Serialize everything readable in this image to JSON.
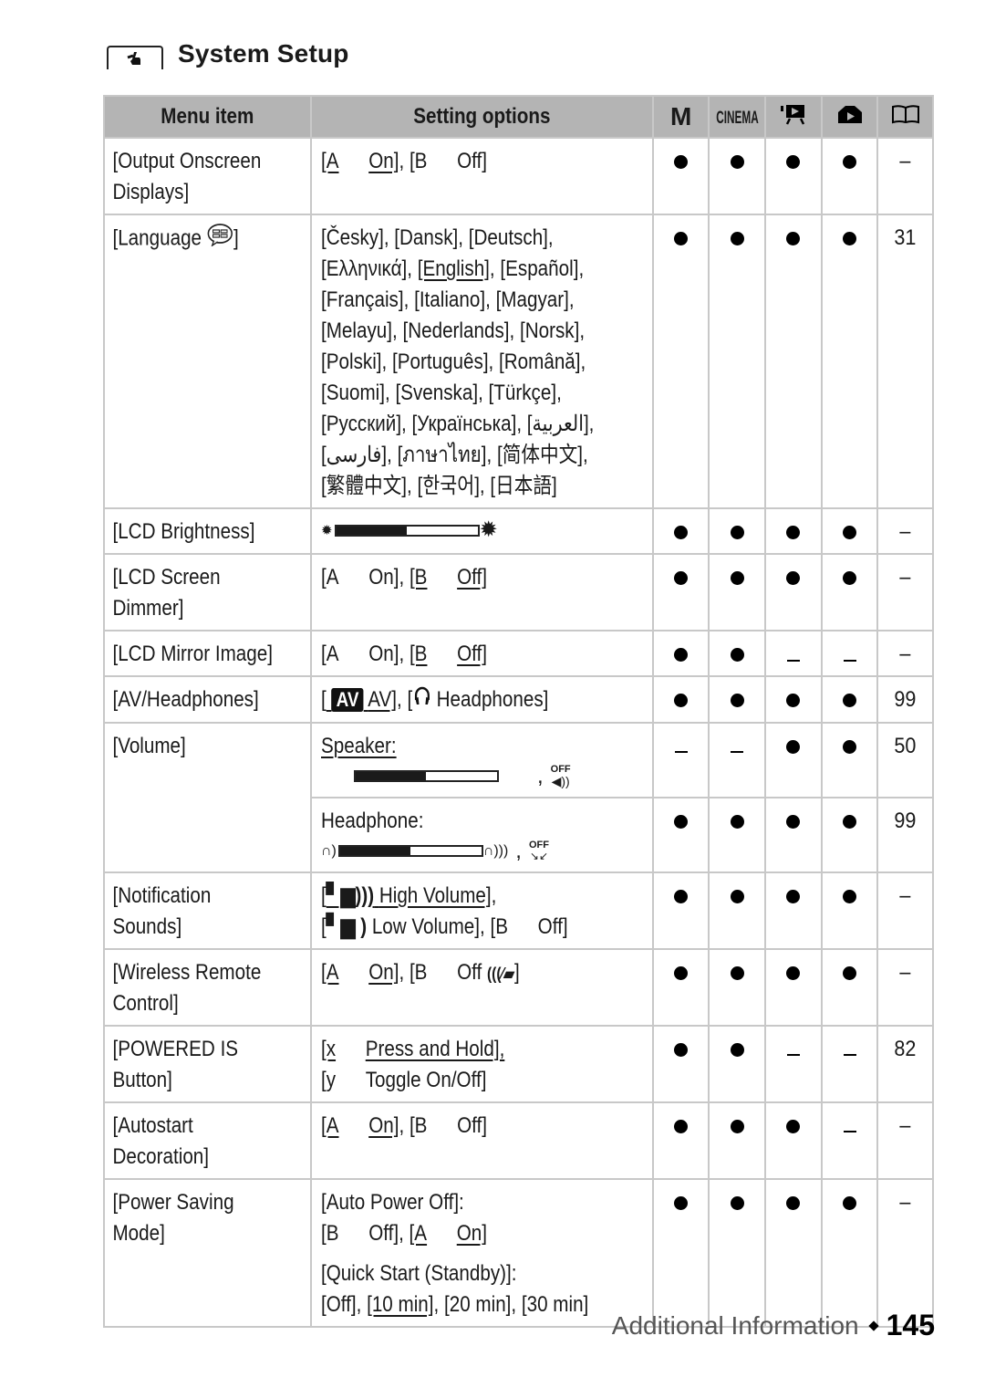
{
  "heading": {
    "icon": "wrench-hand-icon",
    "title": "System Setup"
  },
  "table": {
    "headers": {
      "menu_item": "Menu item",
      "setting_options": "Setting options",
      "mode_m": "M",
      "mode_cinema": "CINEMA",
      "mode_movie_icon": "movie-playback-icon",
      "mode_photo_icon": "photo-playback-icon",
      "page_icon": "book-icon"
    },
    "rows": [
      {
        "item": "[Output Onscreen Displays]",
        "item_lines": [
          "[Output Onscreen",
          "Displays]"
        ],
        "options": {
          "on": "[A",
          "on_label": "On]",
          "sep": ", ",
          "off": "[B",
          "off_label": "Off]"
        },
        "marks": [
          "dot",
          "dot",
          "dot",
          "dot"
        ],
        "page": "–"
      },
      {
        "item": "[Language]",
        "item_label": "[Language",
        "item_icon": "speech-bubble-icon",
        "item_close": "]",
        "options_lines": [
          "[Česky], [Dansk], [Deutsch],",
          "[Ελληνικά], [English], [Español],",
          "[Français], [Italiano], [Magyar],",
          "[Melayu], [Nederlands], [Norsk],",
          "[Polski], [Português], [Română],",
          "[Suomi], [Svenska], [Türkçe],",
          "[Русский], [Українська], [العربية],",
          "[فارسی], [ภาษาไทย], [简体中文],",
          "[繁體中文], [한국어], [日本語]"
        ],
        "line2_parts": {
          "a": "[Ελληνικά], ",
          "b": "[English]",
          "c": ", [Español],"
        },
        "marks": [
          "dot",
          "dot",
          "dot",
          "dot"
        ],
        "page": "31"
      },
      {
        "item": "[LCD Brightness]",
        "options_icon_left": "dim-sun-icon",
        "options_icon_right": "bright-sun-icon",
        "brightness_level": 0.5,
        "marks": [
          "dot",
          "dot",
          "dot",
          "dot"
        ],
        "page": "–"
      },
      {
        "item": "[LCD Screen Dimmer]",
        "item_lines": [
          "[LCD Screen",
          "Dimmer]"
        ],
        "options": {
          "on": "[A",
          "on_label": "On]",
          "sep": ", ",
          "off": "[B",
          "off_label": "Off]"
        },
        "marks": [
          "dot",
          "dot",
          "dot",
          "dot"
        ],
        "page": "–"
      },
      {
        "item": "[LCD Mirror Image]",
        "options": {
          "on": "[A",
          "on_label": "On]",
          "sep": ", ",
          "off": "[B",
          "off_label": "Off]"
        },
        "marks": [
          "dot",
          "dot",
          "dash",
          "dash"
        ],
        "page": "–"
      },
      {
        "item": "[AV/Headphones]",
        "options": {
          "av_open": "[",
          "av_badge": "AV",
          "av_label": "AV]",
          "sep": ", [",
          "hp_label": "Headphones]"
        },
        "marks": [
          "dot",
          "dot",
          "dot",
          "dot"
        ],
        "page": "99"
      },
      {
        "item": "[Volume]",
        "speaker": {
          "label": "Speaker:",
          "level": 0.5,
          "sep": ",",
          "off_icon": "speaker-off-icon",
          "off_text": "OFF"
        },
        "speaker_marks": [
          "dash",
          "dash",
          "dot",
          "dot"
        ],
        "speaker_page": "50",
        "headphone": {
          "label": "Headphone:",
          "level": 0.5,
          "sep": ",",
          "off_icon": "headphone-off-icon",
          "off_text": "OFF"
        },
        "headphone_marks": [
          "dot",
          "dot",
          "dot",
          "dot"
        ],
        "headphone_page": "99"
      },
      {
        "item": "[Notification Sounds]",
        "item_lines": [
          "[Notification",
          "Sounds]"
        ],
        "options": {
          "high": "High Volume]",
          "high_sep": ",",
          "low": "Low Volume], [B",
          "off_label": "Off]"
        },
        "marks": [
          "dot",
          "dot",
          "dot",
          "dot"
        ],
        "page": "–"
      },
      {
        "item": "[Wireless Remote Control]",
        "item_lines": [
          "[Wireless Remote",
          "Control]"
        ],
        "options": {
          "on": "[A",
          "on_label": "On]",
          "sep": ", ",
          "off": "[B",
          "off_label": "Off",
          "close": "]"
        },
        "marks": [
          "dot",
          "dot",
          "dot",
          "dot"
        ],
        "page": "–"
      },
      {
        "item": "[POWERED IS Button]",
        "item_lines": [
          "[POWERED IS",
          "Button]"
        ],
        "options_lines": [
          "[x",
          "Press and Hold],",
          "[y",
          "Toggle On/Off]"
        ],
        "marks": [
          "dot",
          "dot",
          "dash",
          "dash"
        ],
        "page": "82"
      },
      {
        "item": "[Autostart Decoration]",
        "item_lines": [
          "[Autostart",
          "Decoration]"
        ],
        "options": {
          "on": "[A",
          "on_label": "On]",
          "sep": ", ",
          "off": "[B",
          "off_label": "Off]"
        },
        "marks": [
          "dot",
          "dot",
          "dot",
          "dash"
        ],
        "page": "–"
      },
      {
        "item": "[Power Saving Mode]",
        "item_lines": [
          "[Power Saving",
          "Mode]"
        ],
        "auto_power_off": {
          "label": "[Auto Power Off]:",
          "off": "[B",
          "off_label": "Off]",
          "sep": ", ",
          "on": "[A",
          "on_label": "On]"
        },
        "quick_start": {
          "label": "[Quick Start (Standby)]:",
          "opt1": "[Off]",
          "sep1": ", ",
          "opt2": "[10 min]",
          "rest": ", [20 min], [30 min]"
        },
        "marks": [
          "dot",
          "dot",
          "dot",
          "dot"
        ],
        "page": "–"
      }
    ]
  },
  "footer": {
    "section": "Additional Information",
    "page_number": "145"
  }
}
